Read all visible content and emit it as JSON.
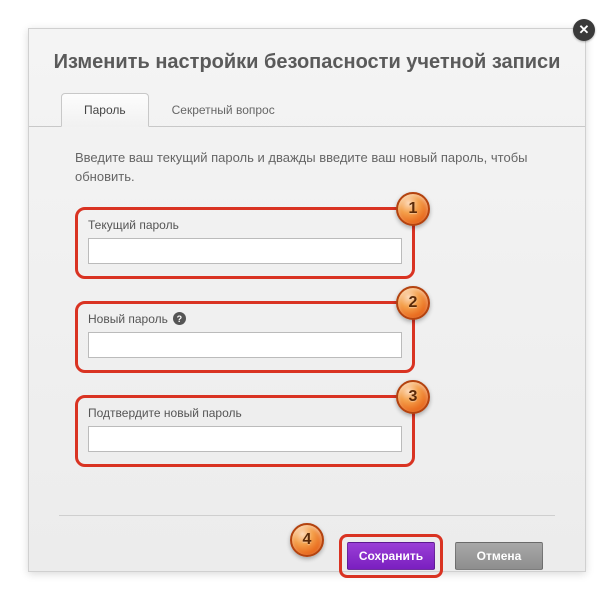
{
  "dialog": {
    "title": "Изменить настройки безопасности учетной записи"
  },
  "tabs": {
    "password": "Пароль",
    "secret_question": "Секретный вопрос"
  },
  "content": {
    "instructions": "Введите ваш текущий пароль и дважды введите ваш новый пароль, чтобы обновить.",
    "current_password_label": "Текущий пароль",
    "new_password_label": "Новый пароль",
    "confirm_password_label": "Подтвердите новый пароль"
  },
  "buttons": {
    "save": "Сохранить",
    "cancel": "Отмена"
  },
  "badges": {
    "b1": "1",
    "b2": "2",
    "b3": "3",
    "b4": "4"
  }
}
